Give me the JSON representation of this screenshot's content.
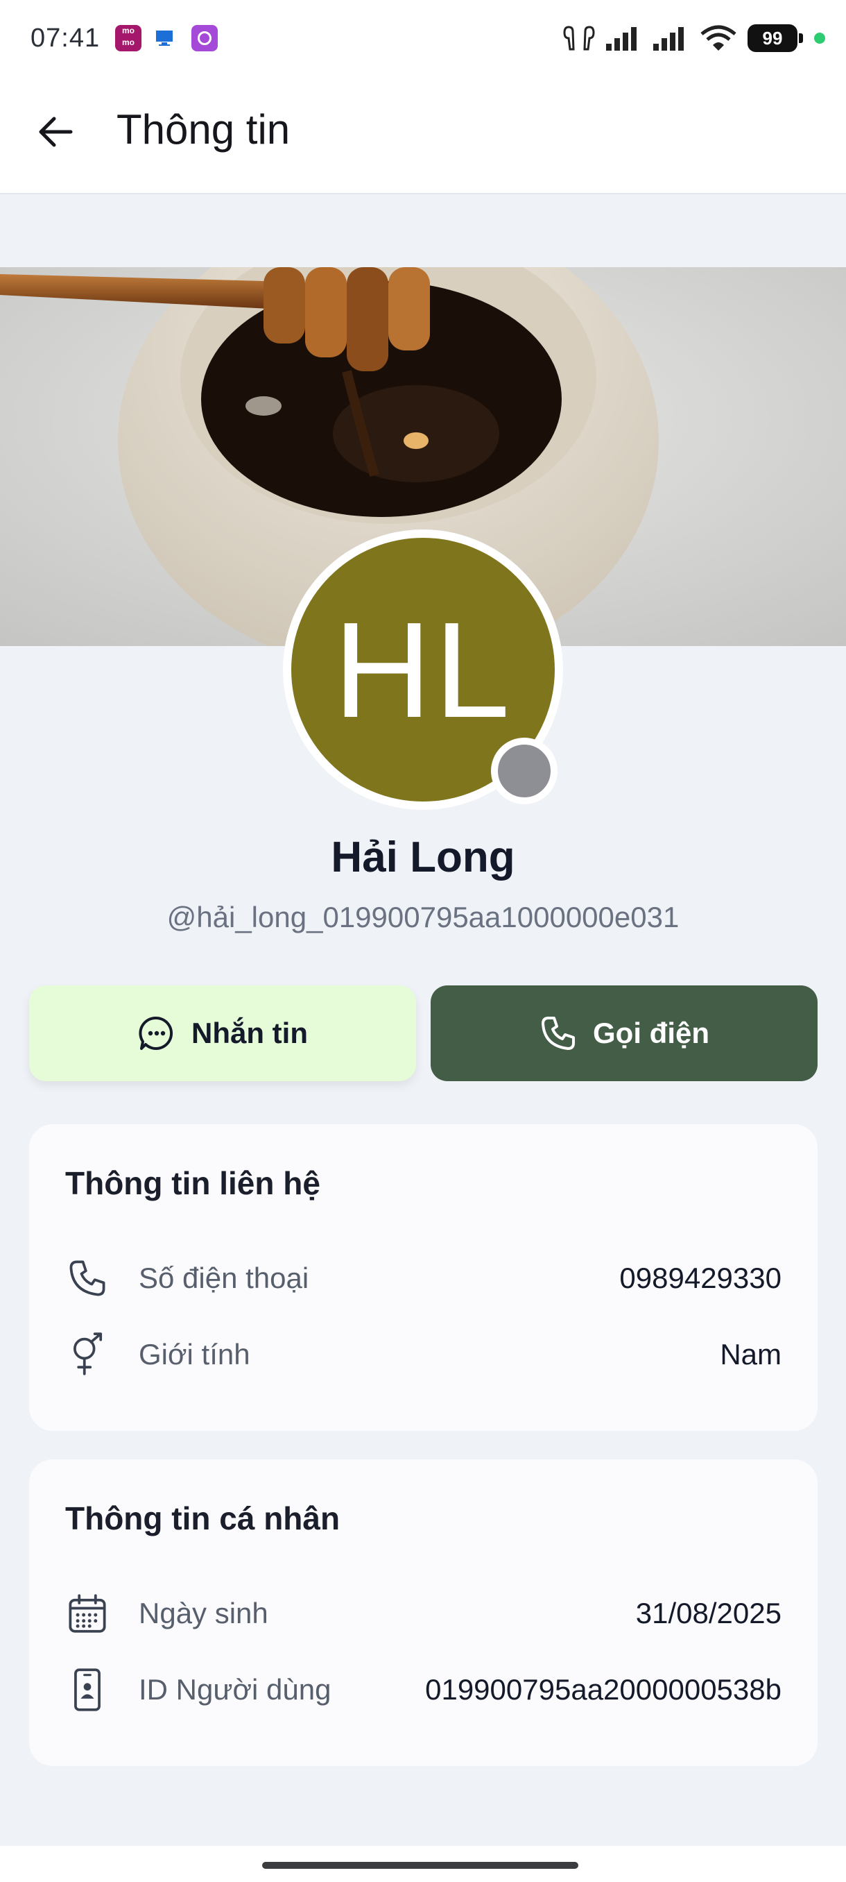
{
  "status_bar": {
    "time": "07:41",
    "battery": "99",
    "app_icons": [
      "momo-icon",
      "computer-icon",
      "circle-app-icon"
    ]
  },
  "appbar": {
    "title": "Thông tin"
  },
  "profile": {
    "initials": "HL",
    "name": "Hải Long",
    "handle": "@hải_long_019900795aa1000000e031",
    "avatar_color": "#7f751c",
    "status": "offline"
  },
  "actions": {
    "message_label": "Nhắn tin",
    "call_label": "Gọi điện"
  },
  "contact_card": {
    "title": "Thông tin liên hệ",
    "rows": [
      {
        "icon": "phone-icon",
        "label": "Số điện thoại",
        "value": "0989429330"
      },
      {
        "icon": "gender-icon",
        "label": "Giới tính",
        "value": "Nam"
      }
    ]
  },
  "personal_card": {
    "title": "Thông tin cá nhân",
    "rows": [
      {
        "icon": "calendar-icon",
        "label": "Ngày sinh",
        "value": "31/08/2025"
      },
      {
        "icon": "id-card-icon",
        "label": "ID Người dùng",
        "value": "019900795aa2000000538b"
      }
    ]
  }
}
